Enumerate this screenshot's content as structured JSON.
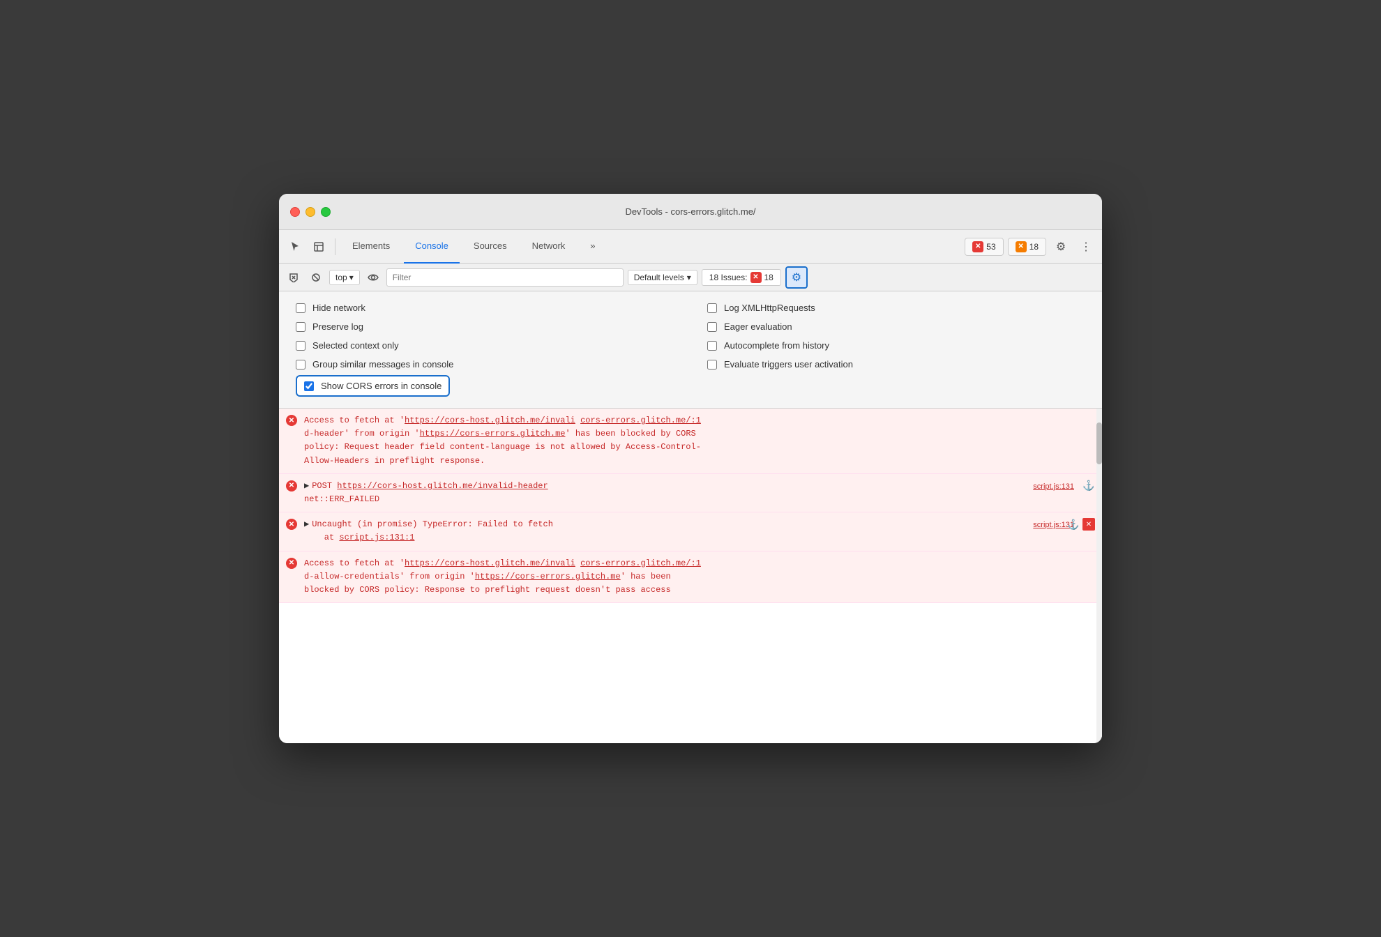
{
  "window": {
    "title": "DevTools - cors-errors.glitch.me/"
  },
  "toolbar": {
    "tabs": [
      {
        "id": "elements",
        "label": "Elements",
        "active": false
      },
      {
        "id": "console",
        "label": "Console",
        "active": true
      },
      {
        "id": "sources",
        "label": "Sources",
        "active": false
      },
      {
        "id": "network",
        "label": "Network",
        "active": false
      },
      {
        "id": "more",
        "label": "»",
        "active": false
      }
    ],
    "badge_errors": "53",
    "badge_warnings": "18",
    "gear_label": "⚙",
    "more_label": "⋮"
  },
  "console_toolbar": {
    "context": "top",
    "filter_placeholder": "Filter",
    "levels_label": "Default levels",
    "issues_label": "18 Issues:",
    "issues_count": "18"
  },
  "settings": {
    "col1": [
      {
        "id": "hide-network",
        "label": "Hide network",
        "checked": false
      },
      {
        "id": "preserve-log",
        "label": "Preserve log",
        "checked": false
      },
      {
        "id": "selected-context",
        "label": "Selected context only",
        "checked": false
      },
      {
        "id": "group-similar",
        "label": "Group similar messages in console",
        "checked": false
      }
    ],
    "col2": [
      {
        "id": "log-xmlhttp",
        "label": "Log XMLHttpRequests",
        "checked": false
      },
      {
        "id": "eager-eval",
        "label": "Eager evaluation",
        "checked": false
      },
      {
        "id": "autocomplete",
        "label": "Autocomplete from history",
        "checked": false
      },
      {
        "id": "evaluate-triggers",
        "label": "Evaluate triggers user activation",
        "checked": false
      }
    ],
    "cors_label": "Show CORS errors in console",
    "cors_checked": true
  },
  "console_entries": [
    {
      "id": "entry1",
      "type": "error",
      "text": "Access to fetch at 'https://cors-host.glitch.me/invali cors-errors.glitch.me/:1\nd-header' from origin 'https://cors-errors.glitch.me' has been blocked by CORS\npolicy: Request header field content-language is not allowed by Access-Control-\nAllow-Headers in preflight response.",
      "link1": "https://cors-host.glitch.me/invali",
      "link2": "cors-errors.glitch.me/:1",
      "link3": "https://cors-errors.glitch.me",
      "has_meta": false
    },
    {
      "id": "entry2",
      "type": "error",
      "text": "POST https://cors-host.glitch.me/invalid-header\nnet::ERR_FAILED",
      "link": "https://cors-host.glitch.me/invalid-header",
      "meta": "script.js:131",
      "has_expand": true,
      "has_meta": true
    },
    {
      "id": "entry3",
      "type": "error",
      "text": "Uncaught (in promise) TypeError: Failed to fetch\n    at script.js:131:1",
      "meta": "script.js:131",
      "has_expand": true,
      "has_meta": true,
      "has_close": true
    },
    {
      "id": "entry4",
      "type": "error",
      "text": "Access to fetch at 'https://cors-host.glitch.me/invali cors-errors.glitch.me/:1\nd-allow-credentials' from origin 'https://cors-errors.glitch.me' has been\nblocked by CORS policy: Response to preflight request doesn't pass access",
      "link1": "https://cors-host.glitch.me/invali",
      "link2": "cors-errors.glitch.me/:1",
      "link3": "https://cors-errors.glitch.me",
      "has_meta": false
    }
  ]
}
